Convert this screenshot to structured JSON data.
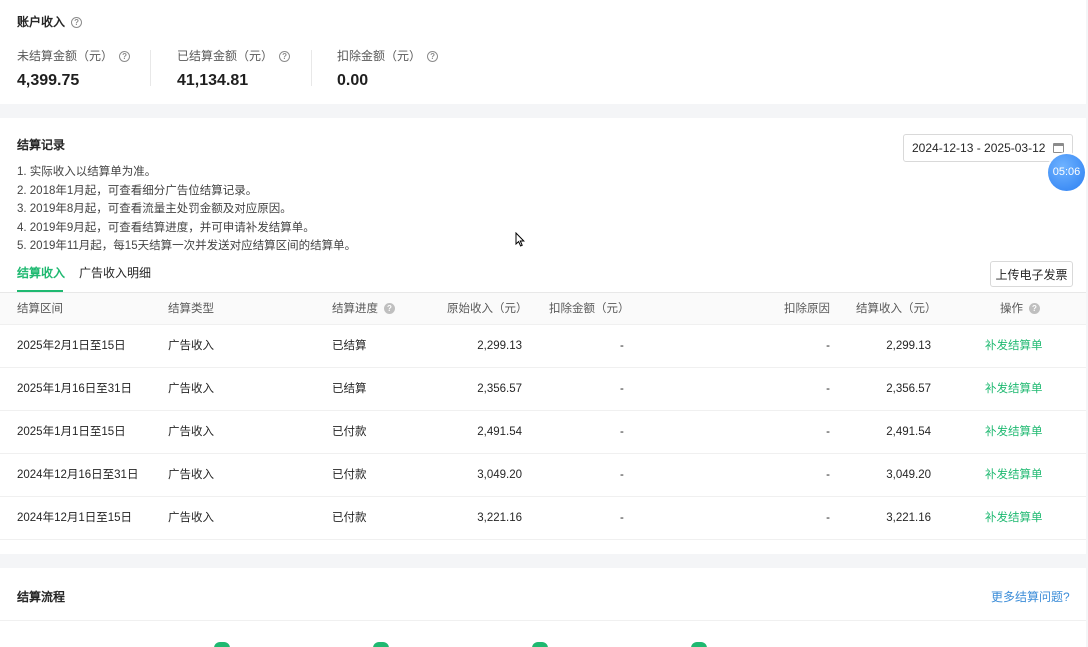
{
  "account": {
    "title": "账户收入",
    "stats": [
      {
        "label": "未结算金额（元）",
        "value": "4,399.75"
      },
      {
        "label": "已结算金额（元）",
        "value": "41,134.81"
      },
      {
        "label": "扣除金额（元）",
        "value": "0.00"
      }
    ]
  },
  "records": {
    "title": "结算记录",
    "date_range": "2024-12-13 - 2025-03-12",
    "notes": [
      "1. 实际收入以结算单为准。",
      "2. 2018年1月起，可查看细分广告位结算记录。",
      "3. 2019年8月起，可查看流量主处罚金额及对应原因。",
      "4. 2019年9月起，可查看结算进度，并可申请补发结算单。",
      "5. 2019年11月起，每15天结算一次并发送对应结算区间的结算单。"
    ],
    "tabs": [
      "结算收入",
      "广告收入明细"
    ],
    "upload_button": "上传电子发票",
    "columns": [
      "结算区间",
      "结算类型",
      "结算进度",
      "原始收入（元）",
      "扣除金额（元）",
      "扣除原因",
      "结算收入（元）",
      "操作"
    ],
    "rows": [
      {
        "period": "2025年2月1日至15日",
        "type": "广告收入",
        "status": "已结算",
        "original": "2,299.13",
        "deduct": "-",
        "reason": "-",
        "settled": "2,299.13",
        "action": "补发结算单"
      },
      {
        "period": "2025年1月16日至31日",
        "type": "广告收入",
        "status": "已结算",
        "original": "2,356.57",
        "deduct": "-",
        "reason": "-",
        "settled": "2,356.57",
        "action": "补发结算单"
      },
      {
        "period": "2025年1月1日至15日",
        "type": "广告收入",
        "status": "已付款",
        "original": "2,491.54",
        "deduct": "-",
        "reason": "-",
        "settled": "2,491.54",
        "action": "补发结算单"
      },
      {
        "period": "2024年12月16日至31日",
        "type": "广告收入",
        "status": "已付款",
        "original": "3,049.20",
        "deduct": "-",
        "reason": "-",
        "settled": "3,049.20",
        "action": "补发结算单"
      },
      {
        "period": "2024年12月1日至15日",
        "type": "广告收入",
        "status": "已付款",
        "original": "3,221.16",
        "deduct": "-",
        "reason": "-",
        "settled": "3,221.16",
        "action": "补发结算单"
      }
    ]
  },
  "flow": {
    "title": "结算流程",
    "more_link": "更多结算问题?"
  },
  "timer": "05:06",
  "colors": {
    "accent": "#1fb971",
    "link_blue": "#3c8dd8",
    "timer_blue": "#2c7ff2"
  },
  "icons": [
    "help-icon",
    "calendar-icon",
    "mouse-cursor-icon"
  ]
}
